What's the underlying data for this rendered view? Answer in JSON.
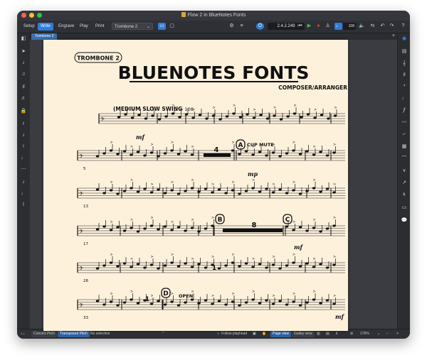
{
  "window": {
    "title": "Flow 2 in BlueNotes Fonts",
    "traffic_lights": [
      "#ff5f57",
      "#febc2e",
      "#28c840"
    ]
  },
  "toolbar": {
    "modes": [
      "Setup",
      "Write",
      "Engrave",
      "Play",
      "Print"
    ],
    "active_mode": "Write",
    "instrument_select": "Trombone 2",
    "timecode": "2.4.2.249",
    "tempo": "108",
    "accent": "#2f7dd9"
  },
  "tab": {
    "label": "Trombone 2"
  },
  "score": {
    "instrument_label": "TROMBONE 2",
    "title": "BLUENOTES FONTS",
    "composer": "COMPOSER/ARRANGER",
    "tempo_text": "(MEDIUM SLOW SWING",
    "tempo_value": "= 108",
    "dynamic_mf": "mf",
    "dynamic_mp": "mp",
    "multirest_4": "4",
    "multirest_8": "8",
    "rehearsal_a": "A",
    "rehearsal_b": "B",
    "rehearsal_c": "C",
    "rehearsal_d": "D",
    "cup_mute": "CUP MUTE",
    "open": "OPEN",
    "measure_numbers": [
      "5",
      "13",
      "17",
      "28",
      "33"
    ],
    "barline_one": "1"
  },
  "statusbar": {
    "concert_pitch": "Concert Pitch",
    "transposed_pitch": "Transposed Pitch",
    "selection": "No selection",
    "follow_playhead": "Follow playhead",
    "page_view": "Page view",
    "galley_view": "Galley view",
    "zoom": "176%"
  },
  "icons": {
    "left": [
      "sidebar-toggle-icon",
      "select-arrow-icon",
      "note-input-icon",
      "notes-icon",
      "sharp-icon",
      "tie-icon",
      "lock-icon",
      "rest-icon",
      "cue-icon",
      "tuplet-icon",
      "grace-icon",
      "dots-icon",
      "accent-icon",
      "voice-icon",
      "slur-icon"
    ],
    "right": [
      "notations-icon",
      "keyboard-icon",
      "clef-icon",
      "key-signature-icon",
      "time-signature-icon",
      "tempo-icon",
      "dynamics-icon",
      "ornaments-icon",
      "repeat-icon",
      "holds-icon",
      "playing-techniques-icon",
      "lines-icon",
      "text-icon",
      "rehearsal-icon",
      "comments-icon"
    ]
  }
}
